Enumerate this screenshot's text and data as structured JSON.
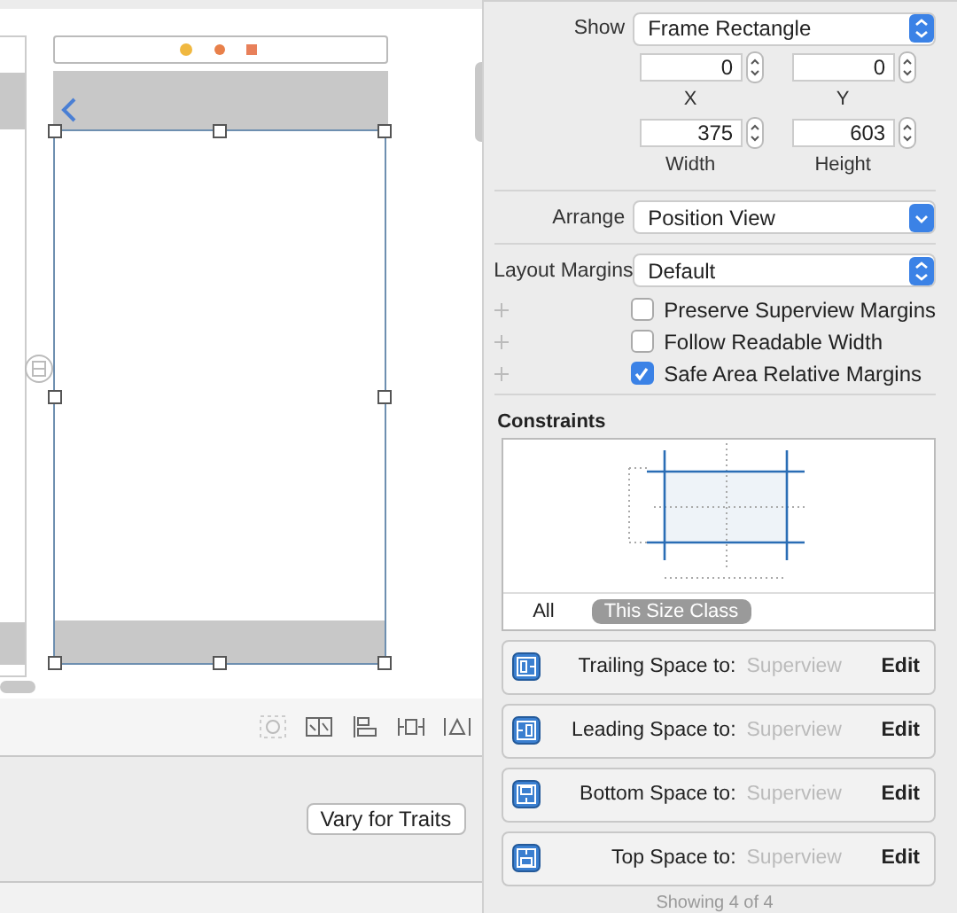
{
  "editor": {
    "vary_button": "Vary for Traits"
  },
  "inspector": {
    "show": {
      "label": "Show",
      "value": "Frame Rectangle",
      "kind": "popup"
    },
    "frame_rows": [
      [
        {
          "label": "X",
          "value": "0"
        },
        {
          "label": "Y",
          "value": "0"
        }
      ],
      [
        {
          "label": "Width",
          "value": "375"
        },
        {
          "label": "Height",
          "value": "603"
        }
      ]
    ],
    "arrange": {
      "label": "Arrange",
      "value": "Position View",
      "kind": "pulldown"
    },
    "layout_margins": {
      "label": "Layout Margins",
      "value": "Default",
      "kind": "popup"
    },
    "checkboxes": [
      {
        "label": "Preserve Superview Margins",
        "checked": false
      },
      {
        "label": "Follow Readable Width",
        "checked": false
      },
      {
        "label": "Safe Area Relative Margins",
        "checked": true
      }
    ],
    "constraints": {
      "title": "Constraints",
      "filters": [
        {
          "label": "All",
          "selected": false
        },
        {
          "label": "This Size Class",
          "selected": true
        }
      ],
      "items": [
        {
          "kind": "trailing",
          "label": "Trailing Space to:",
          "target": "Superview",
          "action": "Edit"
        },
        {
          "kind": "leading",
          "label": "Leading Space to:",
          "target": "Superview",
          "action": "Edit"
        },
        {
          "kind": "bottom",
          "label": "Bottom Space to:",
          "target": "Superview",
          "action": "Edit"
        },
        {
          "kind": "top",
          "label": "Top Space to:",
          "target": "Superview",
          "action": "Edit"
        }
      ],
      "footer": "Showing 4 of 4"
    }
  }
}
